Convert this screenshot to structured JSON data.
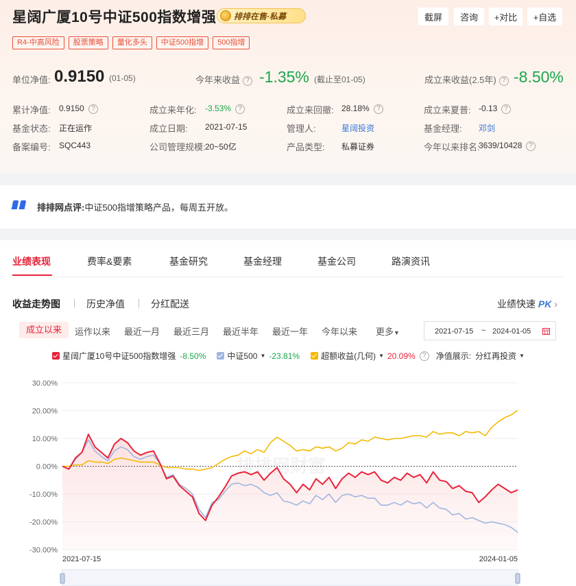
{
  "header": {
    "fund_name": "星阔广厦10号中证500指数增强",
    "badge_text": "排排在售·私募",
    "buttons": [
      "截屏",
      "咨询",
      "+对比",
      "+自选"
    ],
    "tags": [
      "R4-中高风险",
      "股票策略",
      "量化多头",
      "中证500指增",
      "500指增"
    ]
  },
  "metrics": {
    "nav_label": "单位净值:",
    "nav_value": "0.9150",
    "nav_date": "(01-05)",
    "ytd_label": "今年来收益",
    "ytd_value": "-1.35%",
    "ytd_note": "(截止至01-05)",
    "since_label": "成立来收益(2.5年)",
    "since_value": "-8.50%"
  },
  "details": [
    {
      "label": "累计净值:",
      "value": "0.9150",
      "help": true
    },
    {
      "label": "成立来年化:",
      "value": "-3.53%",
      "help": true,
      "color": "green"
    },
    {
      "label": "成立来回撤:",
      "value": "28.18%",
      "help": true
    },
    {
      "label": "成立来夏普:",
      "value": "-0.13",
      "help": true
    },
    {
      "label": "基金状态:",
      "value": "正在运作"
    },
    {
      "label": "成立日期:",
      "value": "2021-07-15"
    },
    {
      "label": "管理人:",
      "value": "星阔投资",
      "color": "blue"
    },
    {
      "label": "基金经理:",
      "value": "邓剑",
      "color": "blue"
    },
    {
      "label": "备案编号:",
      "value": "SQC443"
    },
    {
      "label": "公司管理规模:",
      "value": "20~50亿"
    },
    {
      "label": "产品类型:",
      "value": "私募证券"
    },
    {
      "label": "今年以来排名:",
      "value": "3639/10428",
      "help": true
    }
  ],
  "comment": {
    "label": "排排网点评:",
    "text": "中证500指增策略产品，每周五开放。"
  },
  "tabs": [
    "业绩表现",
    "费率&要素",
    "基金研究",
    "基金经理",
    "基金公司",
    "路演资讯"
  ],
  "subtabs": [
    "收益走势图",
    "历史净值",
    "分红配送"
  ],
  "quick_perf": "业绩快速",
  "quick_perf_pk": "PK",
  "ranges": [
    "成立以来",
    "运作以来",
    "最近一月",
    "最近三月",
    "最近半年",
    "最近一年",
    "今年以来",
    "更多"
  ],
  "date_range": {
    "start": "2021-07-15",
    "sep": "~",
    "end": "2024-01-05"
  },
  "legend": {
    "fund": {
      "name": "星阔广厦10号中证500指数增强",
      "value": "-8.50%"
    },
    "index": {
      "name": "中证500",
      "value": "-23.81%"
    },
    "excess": {
      "name": "超额收益(几何)",
      "value": "20.09%"
    },
    "nav_display_label": "净值展示:",
    "nav_display_value": "分红再投资"
  },
  "colors": {
    "fund": "#e8233a",
    "index": "#9fb6e0",
    "excess": "#f5b800",
    "accent": "#e8233a"
  },
  "chart_data": {
    "type": "line",
    "x_start_label": "2021-07-15",
    "x_end_label": "2024-01-05",
    "y_ticks": [
      "30.00%",
      "20.00%",
      "10.00%",
      "0.00%",
      "-10.00%",
      "-20.00%",
      "-30.00%"
    ],
    "ylim": [
      -30,
      30
    ],
    "series": [
      {
        "name": "星阔广厦10号中证500指数增强",
        "values": [
          0,
          -1,
          3,
          5,
          11.5,
          7,
          5,
          3,
          8,
          10,
          8.5,
          5.5,
          4,
          5,
          5.5,
          1,
          -4.5,
          -3.5,
          -7,
          -9,
          -11,
          -17,
          -19.5,
          -14,
          -11,
          -7.5,
          -3.5,
          -2.5,
          -2,
          -3,
          -2,
          -5,
          -2.5,
          -0.5,
          -4.5,
          -6.5,
          -9.5,
          -6.5,
          -8.5,
          -4.5,
          -6.5,
          -4,
          -8,
          -4.5,
          -2.5,
          -4,
          -2,
          -3,
          -2,
          -5,
          -6,
          -4,
          -5,
          -2.5,
          -4,
          -3,
          -6,
          -2,
          -5,
          -5.5,
          -8,
          -7,
          -9,
          -9.5,
          -13,
          -11,
          -8.5,
          -6.5,
          -8,
          -9.5,
          -8.5
        ]
      },
      {
        "name": "中证500",
        "values": [
          0,
          -1,
          2.5,
          5,
          9.5,
          5.5,
          3.5,
          2,
          5.5,
          7,
          6,
          3.5,
          2.5,
          3.5,
          4,
          1,
          -4,
          -3,
          -6.5,
          -8,
          -10,
          -15.5,
          -18.5,
          -13,
          -12,
          -9,
          -6.5,
          -6,
          -7,
          -6.5,
          -7.5,
          -9.5,
          -10.5,
          -9.5,
          -12.5,
          -13,
          -14,
          -12.5,
          -13.5,
          -10.5,
          -12,
          -10,
          -13,
          -10.5,
          -10,
          -11,
          -10.5,
          -11.5,
          -11.5,
          -14,
          -14,
          -13,
          -14,
          -12.5,
          -13.5,
          -13,
          -15,
          -13,
          -15,
          -15.5,
          -17.5,
          -17,
          -19,
          -18.5,
          -19.5,
          -20.5,
          -20,
          -20.5,
          -21,
          -22,
          -23.8
        ]
      },
      {
        "name": "超额收益(几何)",
        "values": [
          0,
          0,
          0.5,
          0.5,
          2,
          1.5,
          1.5,
          1,
          2.5,
          3,
          2.5,
          2,
          1.5,
          1.5,
          1.5,
          0.5,
          -0.5,
          -0.5,
          -0.5,
          -1,
          -1,
          -1.5,
          -1,
          -0.5,
          1,
          2.5,
          3.5,
          4,
          5.5,
          4.5,
          6,
          5,
          8.5,
          10.5,
          9,
          7.5,
          5.5,
          6,
          5.5,
          7,
          6.5,
          7,
          5.5,
          6.5,
          8.5,
          8,
          9.5,
          9,
          10.5,
          10,
          9.5,
          10,
          10,
          10.5,
          11,
          11,
          10.5,
          12.5,
          11.5,
          12,
          12,
          11,
          12.5,
          12,
          12.5,
          11,
          14,
          16,
          17.5,
          18.5,
          20.1
        ]
      }
    ],
    "baseline": 0,
    "watermark": "排排网财富"
  }
}
